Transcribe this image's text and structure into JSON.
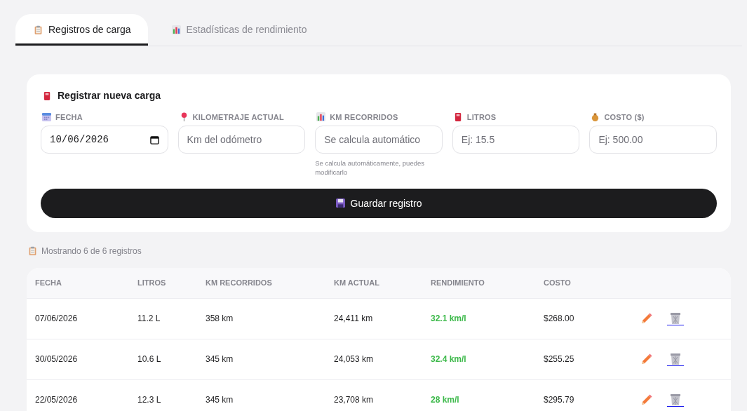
{
  "tabs": [
    {
      "label": "Registros de carga",
      "selected": true
    },
    {
      "label": "Estadísticas de rendimiento",
      "selected": false
    }
  ],
  "form": {
    "title": "Registrar nueva carga",
    "fields": [
      {
        "label": "FECHA",
        "kind": "date",
        "value": "10/06/2026"
      },
      {
        "label": "KILOMETRAJE ACTUAL",
        "kind": "text",
        "placeholder": "Km del odómetro"
      },
      {
        "label": "KM RECORRIDOS",
        "kind": "text",
        "placeholder": "Se calcula automático",
        "hint": "Se calcula automáticamente, puedes modificarlo"
      },
      {
        "label": "LITROS",
        "kind": "text",
        "placeholder": "Ej: 15.5"
      },
      {
        "label": "COSTO ($)",
        "kind": "text",
        "placeholder": "Ej: 500.00"
      }
    ],
    "submit": "Guardar registro"
  },
  "summary": "Mostrando 6 de 6 registros",
  "table": {
    "columns": [
      "FECHA",
      "LITROS",
      "KM RECORRIDOS",
      "KM ACTUAL",
      "RENDIMIENTO",
      "COSTO"
    ],
    "rows": [
      [
        "07/06/2026",
        "11.2 L",
        "358 km",
        "24,411 km",
        "32.1 km/l",
        "$268.00"
      ],
      [
        "30/05/2026",
        "10.6 L",
        "345 km",
        "24,053 km",
        "32.4 km/l",
        "$255.25"
      ],
      [
        "22/05/2026",
        "12.3 L",
        "345 km",
        "23,708 km",
        "28 km/l",
        "$295.79"
      ]
    ]
  }
}
